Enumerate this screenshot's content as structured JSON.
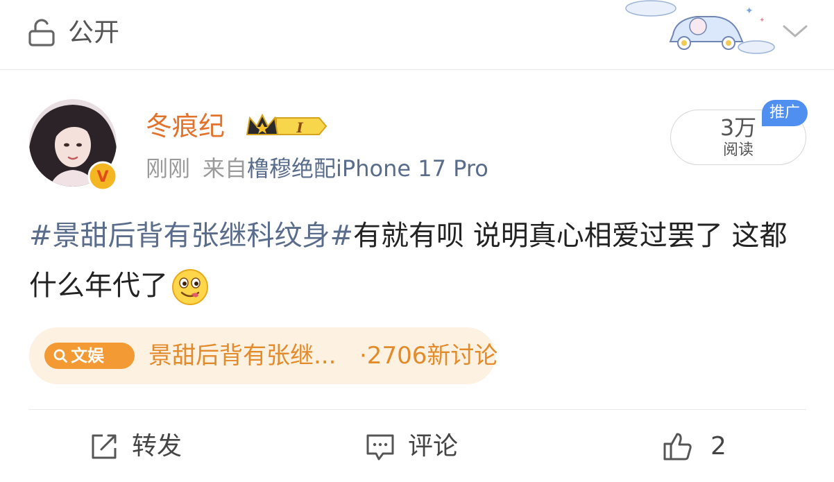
{
  "header": {
    "visibility_label": "公开"
  },
  "author": {
    "name": "冬痕纪",
    "member_level": "I",
    "time": "刚刚",
    "source_prefix": "来自",
    "device": "橹穆绝配iPhone 17 Pro",
    "verified_badge": "V"
  },
  "stats": {
    "read_count": "3万",
    "read_label": "阅读",
    "promo_tag": "推广"
  },
  "post": {
    "hashtag": "#景甜后背有张继科纹身#",
    "text": "有就有呗 说明真心相爱过罢了 这都什么年代了",
    "emoji": "drooling-face"
  },
  "topic": {
    "tag_label": "文娱",
    "title": "景甜后背有张继...",
    "count": "·2706新讨论"
  },
  "actions": {
    "repost_label": "转发",
    "comment_label": "评论",
    "like_count": "2"
  },
  "colors": {
    "author_name": "#e3722b",
    "link": "#5a6c8c",
    "topic_bg": "#fdf1e2",
    "topic_accent": "#f39a34",
    "promo": "#4f8ff0"
  }
}
